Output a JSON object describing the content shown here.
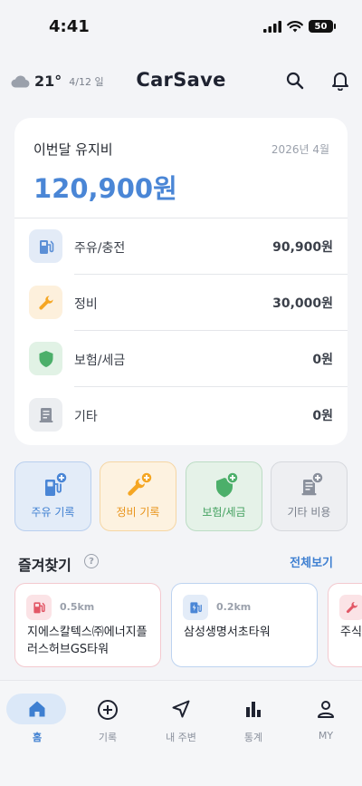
{
  "status_bar": {
    "time": "4:41",
    "battery": "50"
  },
  "header": {
    "temperature": "21°",
    "date": "4/12 일",
    "title": "CarSave",
    "weather_icon": "cloud-icon",
    "search_icon": "search-icon",
    "bell_icon": "bell-icon"
  },
  "summary": {
    "title": "이번달 유지비",
    "month": "2026년 4월",
    "total": "120,900원",
    "items": [
      {
        "label": "주유/충전",
        "value": "90,900원",
        "icon": "fuel-pump-icon"
      },
      {
        "label": "정비",
        "value": "30,000원",
        "icon": "wrench-icon"
      },
      {
        "label": "보험/세금",
        "value": "0원",
        "icon": "shield-icon"
      },
      {
        "label": "기타",
        "value": "0원",
        "icon": "receipt-icon"
      }
    ]
  },
  "quick_actions": [
    {
      "label": "주유 기록",
      "icon": "fuel-pump-add-icon"
    },
    {
      "label": "정비 기록",
      "icon": "wrench-add-icon"
    },
    {
      "label": "보험/세금",
      "icon": "shield-add-icon"
    },
    {
      "label": "기타 비용",
      "icon": "receipt-add-icon"
    }
  ],
  "favorites": {
    "title": "즐겨찾기",
    "see_all": "전체보기",
    "items": [
      {
        "distance": "0.5km",
        "name": "지에스칼텍스㈜에너지플러스허브GS타워",
        "icon": "fuel-pump-icon"
      },
      {
        "distance": "0.2km",
        "name": "삼성생명서초타워",
        "icon": "ev-charger-icon"
      },
      {
        "distance": "",
        "name": "주식",
        "icon": "wrench-icon"
      }
    ]
  },
  "tabs": [
    {
      "label": "홈",
      "icon": "home-icon",
      "active": true
    },
    {
      "label": "기록",
      "icon": "plus-circle-icon",
      "active": false
    },
    {
      "label": "내 주변",
      "icon": "navigation-arrow-icon",
      "active": false
    },
    {
      "label": "통계",
      "icon": "bar-chart-icon",
      "active": false
    },
    {
      "label": "MY",
      "icon": "person-icon",
      "active": false
    }
  ],
  "colors": {
    "accent": "#4a86d6",
    "fuel": "#5b8fd6",
    "maintenance": "#f5a623",
    "insurance": "#4caf6a",
    "other": "#8a909c"
  }
}
